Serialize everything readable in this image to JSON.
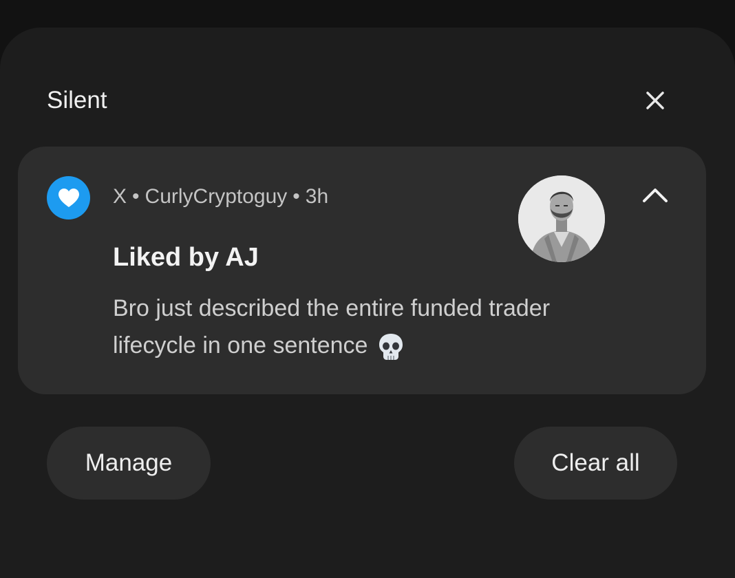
{
  "section": {
    "title": "Silent"
  },
  "notification": {
    "app_name": "X",
    "sender": "CurlyCryptoguy",
    "time": "3h",
    "separator": "•",
    "title": "Liked by AJ",
    "body": "Bro just described the entire funded trader lifecycle in one sentence",
    "emoji": "skull-emoji",
    "app_icon": "heart-icon",
    "accent_color": "#1d9bf0"
  },
  "actions": {
    "manage_label": "Manage",
    "clear_all_label": "Clear all"
  }
}
